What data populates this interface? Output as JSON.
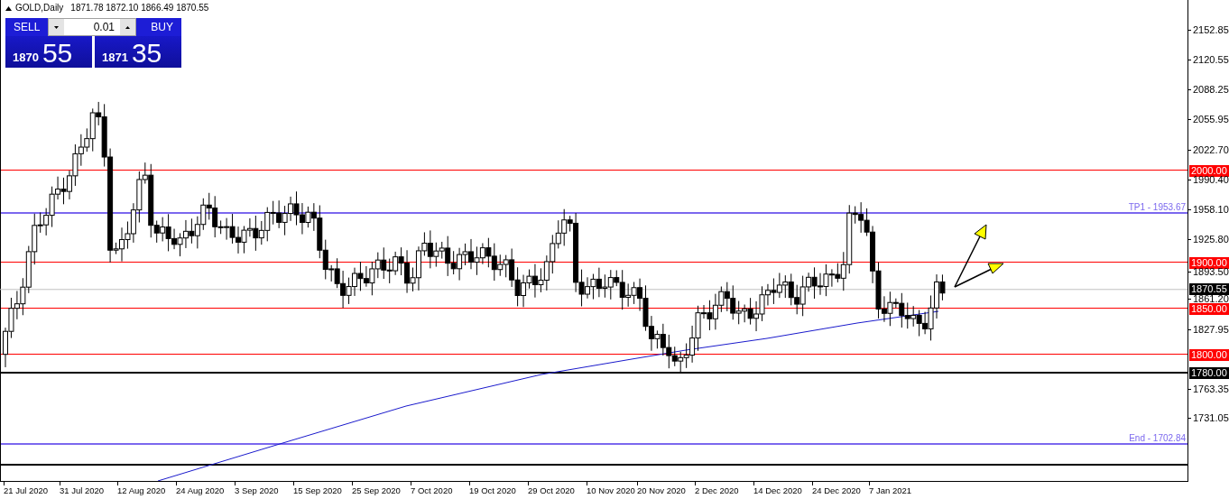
{
  "header": {
    "symbol": "GOLD,Daily",
    "ohlc": "1871.78 1872.10 1866.49 1870.55"
  },
  "trade_panel": {
    "sell": {
      "label": "SELL",
      "price_big": "1870",
      "price_pips": "55"
    },
    "lot": "0.01",
    "buy": {
      "label": "BUY",
      "price_big": "1871",
      "price_pips": "35"
    }
  },
  "price_axis": [
    "2152.85",
    "2120.55",
    "2088.25",
    "2055.95",
    "2022.70",
    "1990.40",
    "1958.10",
    "1925.80",
    "1893.50",
    "1861.20",
    "1827.95",
    "1763.35",
    "1731.05"
  ],
  "current_price": "1870.55",
  "horizontal_lines": [
    {
      "kind": "tagged",
      "color": "#ff0000",
      "tag": "2000.00"
    },
    {
      "kind": "captioned",
      "color": "#7b68ee",
      "caption": "TP1 - 1953.67"
    },
    {
      "kind": "tagged",
      "color": "#ff0000",
      "tag": "1900.00"
    },
    {
      "kind": "tagged",
      "color": "#ff0000",
      "tag": "1850.00"
    },
    {
      "kind": "tagged",
      "color": "#ff0000",
      "tag": "1800.00"
    },
    {
      "kind": "tagged",
      "color": "#000000",
      "tag": "1780.00"
    },
    {
      "kind": "captioned",
      "color": "#7b68ee",
      "caption": "End - 1702.84"
    },
    {
      "kind": "plain",
      "color": "#000000"
    }
  ],
  "date_axis": [
    "21 Jul 2020",
    "31 Jul 2020",
    "12 Aug 2020",
    "24 Aug 2020",
    "3 Sep 2020",
    "15 Sep 2020",
    "25 Sep 2020",
    "7 Oct 2020",
    "19 Oct 2020",
    "29 Oct 2020",
    "10 Nov 2020",
    "20 Nov 2020",
    "2 Dec 2020",
    "14 Dec 2020",
    "24 Dec 2020",
    "7 Jan 2021"
  ]
}
